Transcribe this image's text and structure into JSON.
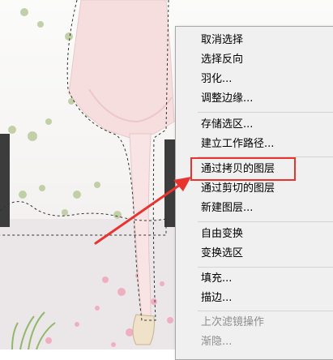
{
  "menu": {
    "items": [
      {
        "label": "取消选择",
        "disabled": false
      },
      {
        "label": "选择反向",
        "disabled": false
      },
      {
        "label": "羽化...",
        "disabled": false
      },
      {
        "label": "调整边缘...",
        "disabled": false
      },
      {
        "label": "存储选区...",
        "disabled": false
      },
      {
        "label": "建立工作路径...",
        "disabled": false
      },
      {
        "label": "通过拷贝的图层",
        "disabled": false
      },
      {
        "label": "通过剪切的图层",
        "disabled": false
      },
      {
        "label": "新建图层...",
        "disabled": false
      },
      {
        "label": "自由变换",
        "disabled": false
      },
      {
        "label": "变换选区",
        "disabled": false
      },
      {
        "label": "填充...",
        "disabled": false
      },
      {
        "label": "描边...",
        "disabled": false
      },
      {
        "label": "上次滤镜操作",
        "disabled": true
      },
      {
        "label": "渐隐...",
        "disabled": true
      }
    ]
  },
  "colors": {
    "highlight": "#e8332f",
    "menu_bg": "#f0f0f0",
    "disabled_text": "#8d8d8d"
  }
}
